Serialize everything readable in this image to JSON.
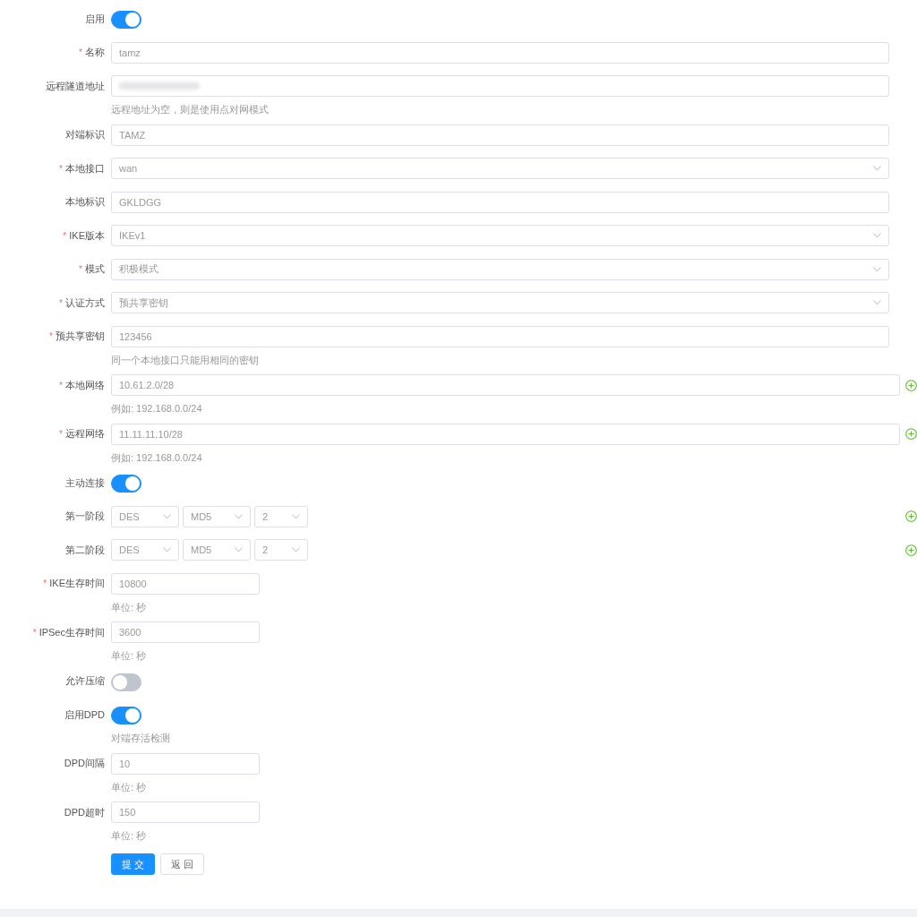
{
  "form": {
    "rows": [
      {
        "kind": "switch",
        "label": "启用",
        "on": true
      },
      {
        "kind": "text",
        "mark": "*",
        "label": "名称",
        "value": "tamz"
      },
      {
        "kind": "redacted",
        "label": "远程隧道地址",
        "hint": "远程地址为空，则是使用点对网模式"
      },
      {
        "kind": "text",
        "label": "对端标识",
        "value": "TAMZ"
      },
      {
        "kind": "select",
        "mark": "*",
        "label": "本地接口",
        "value": "wan"
      },
      {
        "kind": "text",
        "label": "本地标识",
        "value": "GKLDGG"
      },
      {
        "kind": "select",
        "mark": "*",
        "label": "IKE版本",
        "value": "IKEv1"
      },
      {
        "kind": "select",
        "mark": "*",
        "label": "模式",
        "value": "积极模式"
      },
      {
        "kind": "select",
        "mark": "*",
        "label": "认证方式",
        "value": "预共享密钥"
      },
      {
        "kind": "text",
        "mark": "*",
        "label": "预共享密钥",
        "value": "123456",
        "hint": "同一个本地接口只能用相同的密钥"
      },
      {
        "kind": "text",
        "mark": "*",
        "label": "本地网络",
        "value": "10.61.2.0/28",
        "hint": "例如: 192.168.0.0/24",
        "addable": true
      },
      {
        "kind": "text",
        "mark": "*",
        "label": "远程网络",
        "value": "11.11.11.10/28",
        "hint": "例如: 192.168.0.0/24",
        "addable": true
      },
      {
        "kind": "switch",
        "label": "主动连接",
        "on": true
      },
      {
        "kind": "select_group",
        "label": "第一阶段",
        "values": [
          "DES",
          "MD5",
          "2"
        ],
        "addable": true
      },
      {
        "kind": "select_group",
        "label": "第二阶段",
        "values": [
          "DES",
          "MD5",
          "2"
        ],
        "addable": true
      },
      {
        "kind": "short_text",
        "mark": "*",
        "label": "IKE生存时间",
        "value": "10800",
        "hint": "单位: 秒"
      },
      {
        "kind": "short_text",
        "mark": "*",
        "label": "IPSec生存时间",
        "value": "3600",
        "hint": "单位: 秒"
      },
      {
        "kind": "switch",
        "label": "允许压缩",
        "on": false
      },
      {
        "kind": "switch",
        "label": "启用DPD",
        "on": true,
        "hint": "对端存活检测"
      },
      {
        "kind": "short_text",
        "label": "DPD间隔",
        "value": "10",
        "hint": "单位: 秒"
      },
      {
        "kind": "short_text",
        "label": "DPD超时",
        "value": "150",
        "hint": "单位: 秒"
      }
    ],
    "buttons": [
      {
        "label": "提 交",
        "primary": true
      },
      {
        "label": "返 回",
        "primary": false
      }
    ]
  }
}
